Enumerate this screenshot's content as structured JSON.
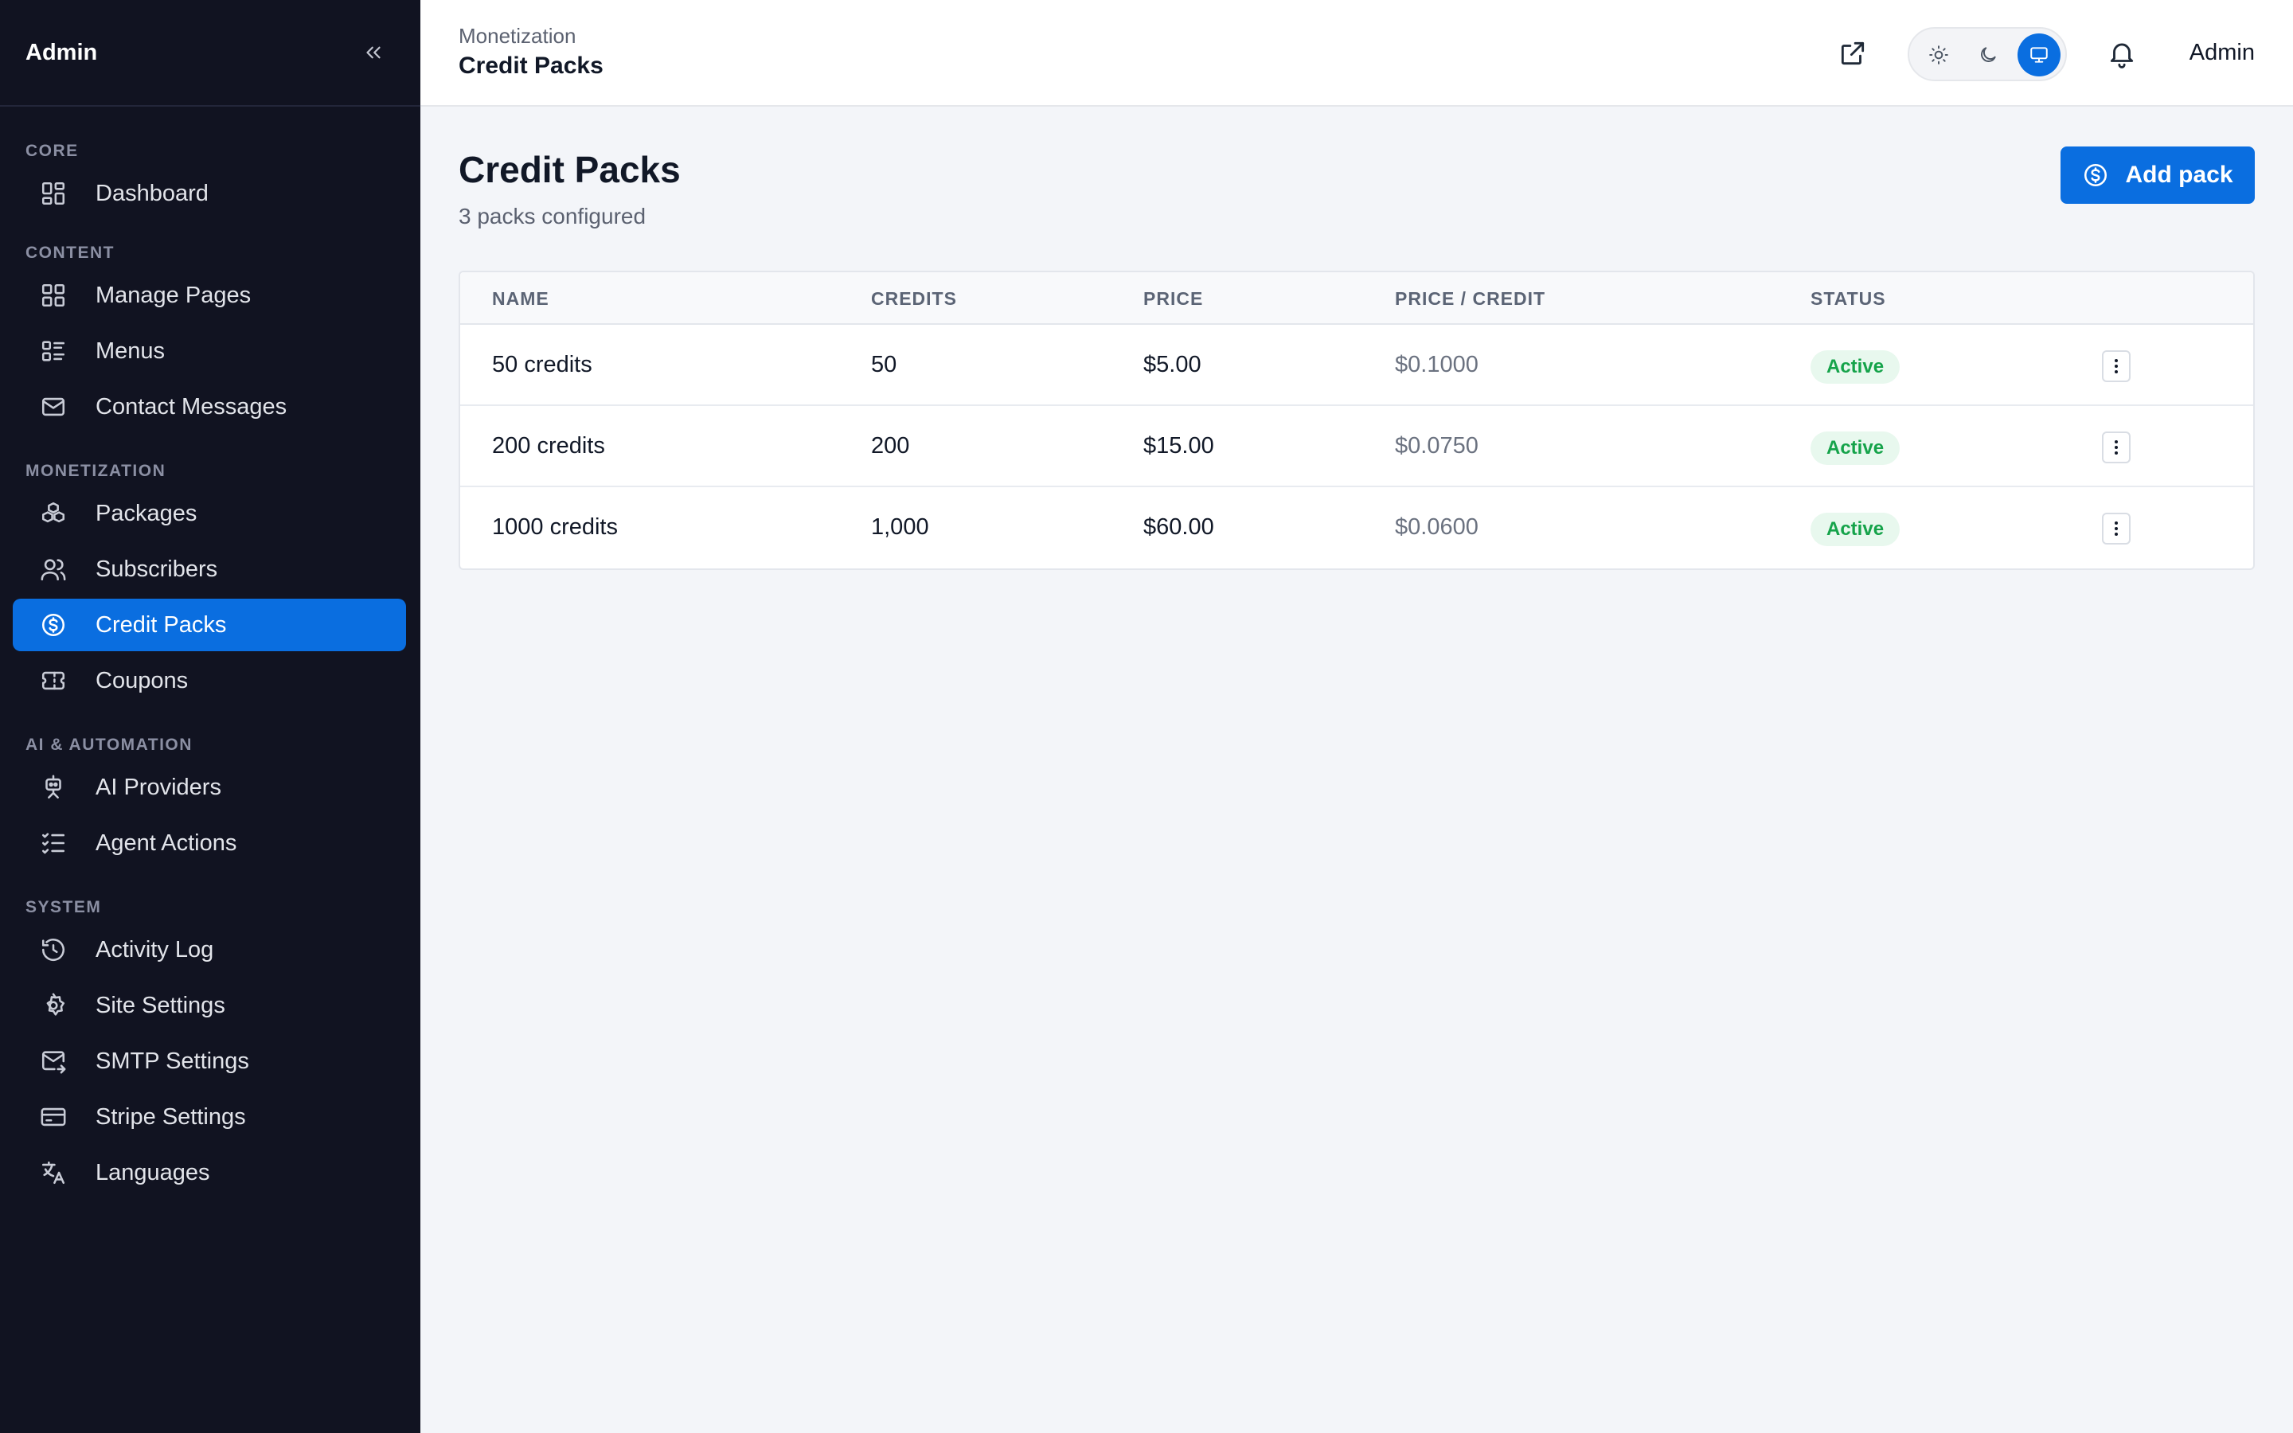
{
  "sidebar": {
    "brand": "Admin",
    "sections": [
      {
        "label": "CORE",
        "items": [
          {
            "label": "Dashboard",
            "icon": "dashboard-grid-icon"
          }
        ]
      },
      {
        "label": "CONTENT",
        "items": [
          {
            "label": "Manage Pages",
            "icon": "pages-grid-icon"
          },
          {
            "label": "Menus",
            "icon": "menu-list-icon"
          },
          {
            "label": "Contact Messages",
            "icon": "mail-icon"
          }
        ]
      },
      {
        "label": "MONETIZATION",
        "items": [
          {
            "label": "Packages",
            "icon": "boxes-icon"
          },
          {
            "label": "Subscribers",
            "icon": "users-icon"
          },
          {
            "label": "Credit Packs",
            "icon": "dollar-circle-icon",
            "active": true
          },
          {
            "label": "Coupons",
            "icon": "ticket-icon"
          }
        ]
      },
      {
        "label": "AI & AUTOMATION",
        "items": [
          {
            "label": "AI Providers",
            "icon": "robot-icon"
          },
          {
            "label": "Agent Actions",
            "icon": "checklist-icon"
          }
        ]
      },
      {
        "label": "SYSTEM",
        "items": [
          {
            "label": "Activity Log",
            "icon": "history-icon"
          },
          {
            "label": "Site Settings",
            "icon": "gear-icon"
          },
          {
            "label": "SMTP Settings",
            "icon": "mail-send-icon"
          },
          {
            "label": "Stripe Settings",
            "icon": "credit-card-icon"
          },
          {
            "label": "Languages",
            "icon": "translate-icon"
          }
        ]
      }
    ]
  },
  "topbar": {
    "breadcrumb": "Monetization",
    "title": "Credit Packs",
    "user": "Admin",
    "theme": "system"
  },
  "main": {
    "title": "Credit Packs",
    "subtitle": "3 packs configured",
    "add_label": "Add pack",
    "columns": [
      "NAME",
      "CREDITS",
      "PRICE",
      "PRICE / CREDIT",
      "STATUS"
    ],
    "rows": [
      {
        "name": "50 credits",
        "credits": "50",
        "price": "$5.00",
        "price_per_credit": "$0.1000",
        "status": "Active"
      },
      {
        "name": "200 credits",
        "credits": "200",
        "price": "$15.00",
        "price_per_credit": "$0.0750",
        "status": "Active"
      },
      {
        "name": "1000 credits",
        "credits": "1,000",
        "price": "$60.00",
        "price_per_credit": "$0.0600",
        "status": "Active"
      }
    ]
  },
  "colors": {
    "accent": "#0a6ee0",
    "sidebar_bg": "#111321",
    "active_badge": "#15a34a"
  }
}
